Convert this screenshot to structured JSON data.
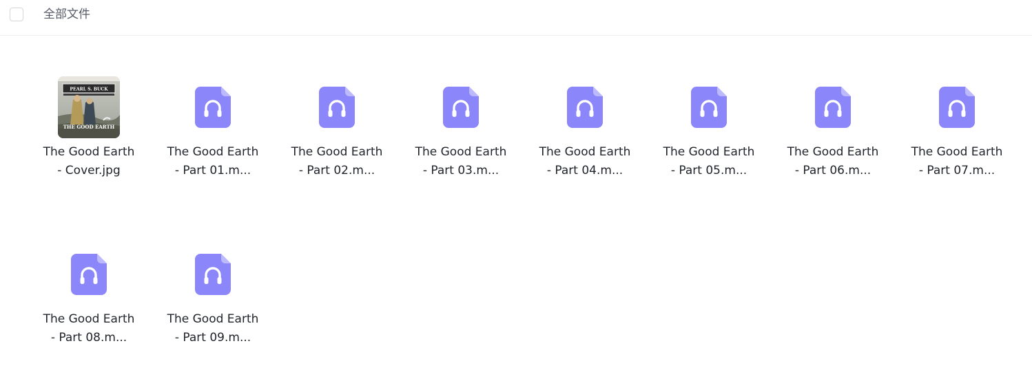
{
  "toolbar": {
    "breadcrumb": "全部文件"
  },
  "files": [
    {
      "name": "The Good Earth - Cover.jpg",
      "type": "image",
      "icon": "image-thumbnail",
      "cover_title": "THE GOOD EARTH",
      "cover_author": "PEARL S. BUCK"
    },
    {
      "name": "The Good Earth - Part 01.m...",
      "type": "audio",
      "icon": "headphones-icon"
    },
    {
      "name": "The Good Earth - Part 02.m...",
      "type": "audio",
      "icon": "headphones-icon"
    },
    {
      "name": "The Good Earth - Part 03.m...",
      "type": "audio",
      "icon": "headphones-icon"
    },
    {
      "name": "The Good Earth - Part 04.m...",
      "type": "audio",
      "icon": "headphones-icon"
    },
    {
      "name": "The Good Earth - Part 05.m...",
      "type": "audio",
      "icon": "headphones-icon"
    },
    {
      "name": "The Good Earth - Part 06.m...",
      "type": "audio",
      "icon": "headphones-icon"
    },
    {
      "name": "The Good Earth - Part 07.m...",
      "type": "audio",
      "icon": "headphones-icon"
    },
    {
      "name": "The Good Earth - Part 08.m...",
      "type": "audio",
      "icon": "headphones-icon"
    },
    {
      "name": "The Good Earth - Part 09.m...",
      "type": "audio",
      "icon": "headphones-icon"
    }
  ],
  "colors": {
    "audio_icon": "#8b86fa",
    "audio_icon_fold": "#bdb9fd",
    "text": "#1f2329",
    "breadcrumb": "#555a66"
  }
}
